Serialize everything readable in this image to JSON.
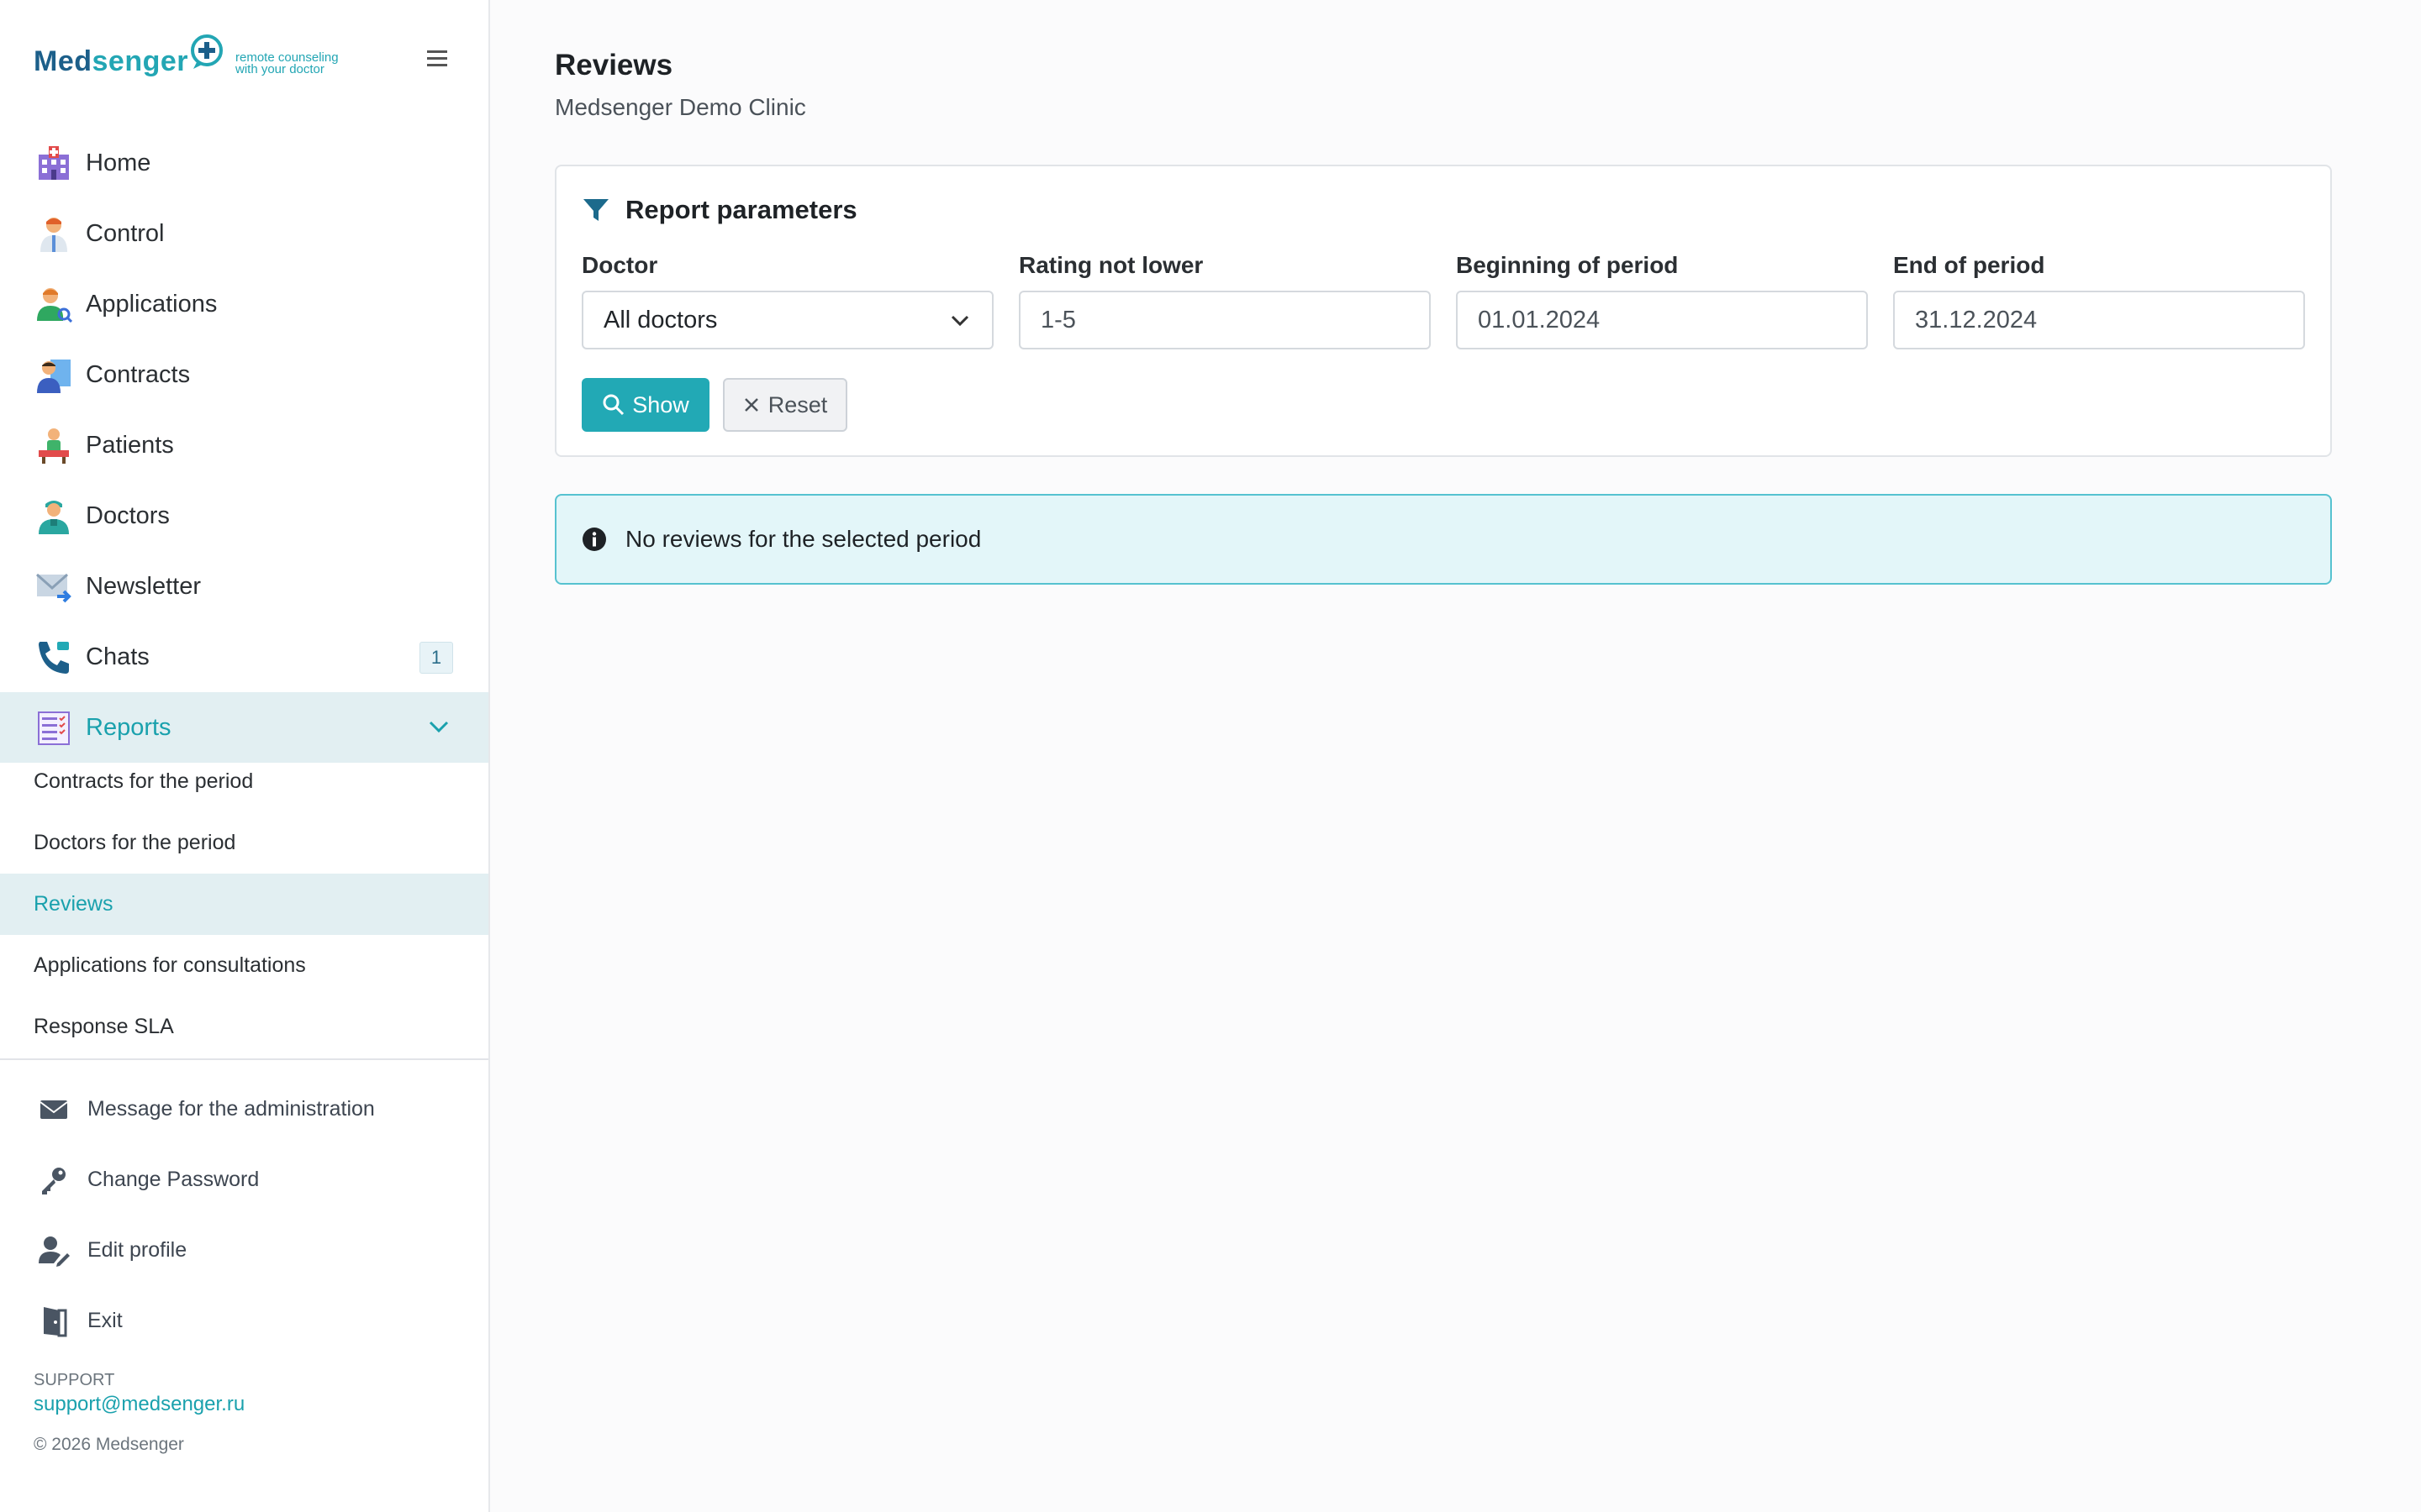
{
  "brand": {
    "name_part1": "Med",
    "name_part2": "senger",
    "tagline_line1": "remote counseling",
    "tagline_line2": "with your doctor"
  },
  "sidebar": {
    "items": [
      {
        "label": "Home",
        "icon": "hospital-icon"
      },
      {
        "label": "Control",
        "icon": "doctor-icon"
      },
      {
        "label": "Applications",
        "icon": "user-search-icon"
      },
      {
        "label": "Contracts",
        "icon": "contract-icon"
      },
      {
        "label": "Patients",
        "icon": "patient-icon"
      },
      {
        "label": "Doctors",
        "icon": "nurse-icon"
      },
      {
        "label": "Newsletter",
        "icon": "mail-icon"
      },
      {
        "label": "Chats",
        "icon": "phone-icon",
        "badge": "1"
      },
      {
        "label": "Reports",
        "icon": "report-icon",
        "active": true
      }
    ],
    "reports_sub": [
      {
        "label": "Contracts for the period"
      },
      {
        "label": "Doctors for the period"
      },
      {
        "label": "Reviews",
        "active": true
      },
      {
        "label": "Applications for consultations"
      },
      {
        "label": "Response SLA"
      }
    ],
    "bottom": [
      {
        "label": "Message for the administration",
        "icon": "envelope-icon"
      },
      {
        "label": "Change Password",
        "icon": "key-icon"
      },
      {
        "label": "Edit profile",
        "icon": "user-edit-icon"
      },
      {
        "label": "Exit",
        "icon": "door-exit-icon"
      }
    ],
    "support_label": "SUPPORT",
    "support_email": "support@medsenger.ru",
    "copyright": "© 2026 Medsenger"
  },
  "main": {
    "title": "Reviews",
    "subtitle": "Medsenger Demo Clinic",
    "params": {
      "title": "Report parameters",
      "doctor_label": "Doctor",
      "doctor_value": "All doctors",
      "rating_label": "Rating not lower",
      "rating_value": "1-5",
      "begin_label": "Beginning of period",
      "begin_value": "01.01.2024",
      "end_label": "End of period",
      "end_value": "31.12.2024",
      "show_label": "Show",
      "reset_label": "Reset"
    },
    "alert": "No reviews for the selected period"
  },
  "colors": {
    "accent": "#22a9b5",
    "brand_dark": "#1c5f8a",
    "active_bg": "#e2eff2",
    "alert_bg": "#e3f6f9"
  }
}
